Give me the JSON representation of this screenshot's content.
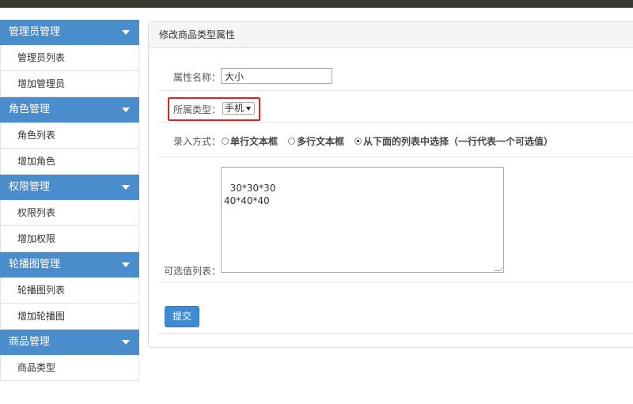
{
  "sidebar": {
    "groups": [
      {
        "title": "管理员管理",
        "items": [
          "管理员列表",
          "增加管理员"
        ]
      },
      {
        "title": "角色管理",
        "items": [
          "角色列表",
          "增加角色"
        ]
      },
      {
        "title": "权限管理",
        "items": [
          "权限列表",
          "增加权限"
        ]
      },
      {
        "title": "轮播图管理",
        "items": [
          "轮播图列表",
          "增加轮播图"
        ]
      },
      {
        "title": "商品管理",
        "items": [
          "商品类型"
        ]
      }
    ]
  },
  "panel": {
    "title": "修改商品类型属性"
  },
  "form": {
    "name_label": "属性名称：",
    "name_value": "大小",
    "type_label": "所属类型：",
    "type_selected": "手机",
    "input_mode_label": "录入方式：",
    "input_modes": [
      "单行文本框",
      "多行文本框",
      "从下面的列表中选择（一行代表一个可选值）"
    ],
    "input_mode_checked": 2,
    "values_label": "可选值列表：",
    "values_text": "30*30*30\n40*40*40",
    "submit_label": "提交"
  },
  "colors": {
    "sidebar_header": "#4a8dcc",
    "submit_button": "#3d8bd6",
    "highlight_border": "#e02020"
  }
}
